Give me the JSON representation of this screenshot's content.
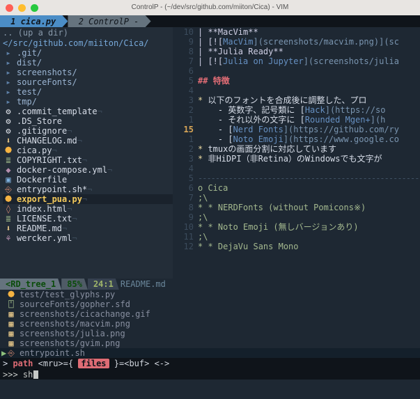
{
  "window_title": "ControlP - (~/dev/src/github.com/miiton/Cica) - VIM",
  "tabs": [
    {
      "label": " 1 cica.py ",
      "active": true
    },
    {
      "label": " 2 ControlP - ",
      "active": false
    }
  ],
  "nerdtree": {
    "up": ".. (up a dir)",
    "path": "</src/github.com/miiton/Cica/",
    "items": [
      {
        "icon": "▸",
        "cls": "folder",
        "name": ".git/"
      },
      {
        "icon": "▸",
        "cls": "folder",
        "name": "dist/"
      },
      {
        "icon": "▸",
        "cls": "folder",
        "name": "screenshots/"
      },
      {
        "icon": "▸",
        "cls": "folder",
        "name": "sourceFonts/"
      },
      {
        "icon": "▸",
        "cls": "folder",
        "name": "test/"
      },
      {
        "icon": "▸",
        "cls": "folder",
        "name": "tmp/"
      },
      {
        "icon": "⚙",
        "cls": "gear",
        "name": ".commit_template",
        "trail": "¬"
      },
      {
        "icon": "⚙",
        "cls": "gear",
        "name": ".DS_Store"
      },
      {
        "icon": "⚙",
        "cls": "gear",
        "name": ".gitignore",
        "trail": "¬"
      },
      {
        "icon": "⬇",
        "cls": "md",
        "name": "CHANGELOG.md",
        "trail": "¬"
      },
      {
        "icon": "⯄",
        "cls": "py",
        "name": "cica.py",
        "trail": "¬"
      },
      {
        "icon": "≣",
        "cls": "txt",
        "name": "COPYRIGHT.txt",
        "trail": "¬"
      },
      {
        "icon": "◆",
        "cls": "yml",
        "name": "docker-compose.yml",
        "trail": "¬"
      },
      {
        "icon": "▣",
        "cls": "docker",
        "name": "Dockerfile"
      },
      {
        "icon": "⎆",
        "cls": "sh",
        "name": "entrypoint.sh*",
        "trail": "¬"
      },
      {
        "icon": "⯄",
        "cls": "py",
        "name": "export_pua.py",
        "trail": "¬",
        "sel": true
      },
      {
        "icon": "◊",
        "cls": "html",
        "name": "index.html",
        "trail": "¬"
      },
      {
        "icon": "≣",
        "cls": "txt",
        "name": "LICENSE.txt",
        "trail": "¬"
      },
      {
        "icon": "⬇",
        "cls": "md",
        "name": "README.md",
        "trail": "¬"
      },
      {
        "icon": "⚘",
        "cls": "yml",
        "name": "wercker.yml",
        "trail": "¬"
      }
    ]
  },
  "editor": {
    "current_line": 15,
    "lines": [
      {
        "n": 10,
        "frag": [
          [
            "md-bold",
            "| **MacVim**"
          ]
        ]
      },
      {
        "n": 9,
        "frag": [
          [
            "md-bold",
            "| [!["
          ],
          [
            "md-link",
            "MacVim"
          ],
          [
            "md-paren",
            "](screenshots/macvim.png)](sc"
          ]
        ]
      },
      {
        "n": 8,
        "frag": [
          [
            "md-bold",
            "| **Julia Ready**"
          ]
        ]
      },
      {
        "n": 7,
        "frag": [
          [
            "md-bold",
            "| [!["
          ],
          [
            "md-link",
            "Julia on Jupyter"
          ],
          [
            "md-paren",
            "](screenshots/julia"
          ]
        ]
      },
      {
        "n": 6,
        "frag": []
      },
      {
        "n": 5,
        "frag": [
          [
            "md-head",
            "## "
          ],
          [
            "md-head t",
            "特徴"
          ]
        ]
      },
      {
        "n": 4,
        "frag": []
      },
      {
        "n": 3,
        "frag": [
          [
            "md-bul",
            "* "
          ],
          [
            "md-plain",
            "以下のフォントを合成後に調整した、プロ"
          ]
        ]
      },
      {
        "n": 2,
        "frag": [
          [
            "md-plain",
            "    - 英数字、記号類に ["
          ],
          [
            "md-link",
            "Hack"
          ],
          [
            "md-paren",
            "](https://so"
          ]
        ]
      },
      {
        "n": 1,
        "frag": [
          [
            "md-plain",
            "    - それ以外の文字に ["
          ],
          [
            "md-link",
            "Rounded Mgen+"
          ],
          [
            "md-paren",
            "](h"
          ]
        ]
      },
      {
        "n": 15,
        "cur": true,
        "frag": [
          [
            "md-plain",
            "    - ["
          ],
          [
            "md-link",
            "Nerd Fonts"
          ],
          [
            "md-paren",
            "](https://github.com/ry"
          ]
        ]
      },
      {
        "n": 1,
        "frag": [
          [
            "md-plain",
            "    - ["
          ],
          [
            "md-link",
            "Noto Emoji"
          ],
          [
            "md-paren",
            "](https://www.google.co"
          ]
        ]
      },
      {
        "n": 2,
        "frag": [
          [
            "md-bul",
            "* "
          ],
          [
            "md-plain",
            "tmuxの画面分割に対応しています"
          ]
        ]
      },
      {
        "n": 3,
        "frag": [
          [
            "md-bul",
            "* "
          ],
          [
            "md-plain",
            "非HiDPI（非Retina）のWindowsでも文字が"
          ]
        ]
      },
      {
        "n": 4,
        "frag": []
      },
      {
        "n": 5,
        "frag": [
          [
            "long-dash",
            "-----------------------------------------------------"
          ]
        ]
      },
      {
        "n": 6,
        "frag": [
          [
            "md-cite",
            "o Cica"
          ]
        ]
      },
      {
        "n": 7,
        "frag": [
          [
            "md-cite",
            ";\\"
          ]
        ]
      },
      {
        "n": 8,
        "frag": [
          [
            "md-cite",
            "* * NERDFonts (without Pomicons※)"
          ]
        ]
      },
      {
        "n": 9,
        "frag": [
          [
            "md-cite",
            ";\\"
          ]
        ]
      },
      {
        "n": 10,
        "frag": [
          [
            "md-cite",
            "* * Noto Emoji (無しバージョンあり)"
          ]
        ]
      },
      {
        "n": 11,
        "frag": [
          [
            "md-cite",
            ";\\"
          ]
        ]
      },
      {
        "n": 12,
        "frag": [
          [
            "md-cite",
            "* * DejaVu Sans Mono"
          ]
        ]
      }
    ],
    "status_file": "README.md"
  },
  "statusline": {
    "tree_label": "<RD_tree_1",
    "percent": "85%",
    "pos": "24:1"
  },
  "ctrlp": {
    "rows": [
      {
        "icon": "⯄",
        "cls": "py",
        "text": "test/test_glyphs.py"
      },
      {
        "icon": "⍞",
        "cls": "txt",
        "text": "sourceFonts/gopher.sfd"
      },
      {
        "icon": "▦",
        "cls": "md",
        "text": "screenshots/cicachange.gif"
      },
      {
        "icon": "▦",
        "cls": "md",
        "text": "screenshots/macvim.png"
      },
      {
        "icon": "▦",
        "cls": "md",
        "text": "screenshots/julia.png"
      },
      {
        "icon": "▦",
        "cls": "md",
        "text": "screenshots/gvim.png"
      },
      {
        "icon": "⎆",
        "cls": "sh",
        "text": "entrypoint.sh",
        "sel": true
      }
    ],
    "status": {
      "mode_path": "path",
      "mode_mid": "<mru>={",
      "mode_files": "files",
      "mode_tail": "}=<buf> <->"
    },
    "prompt": ">>> sh"
  }
}
